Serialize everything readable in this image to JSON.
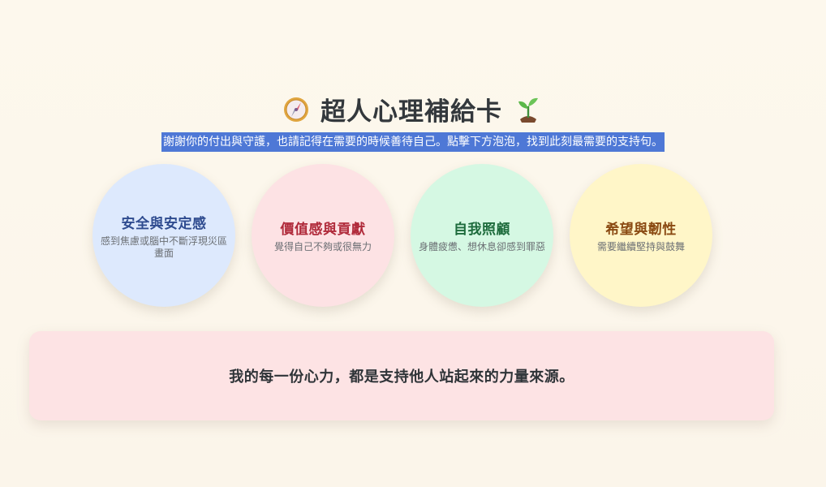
{
  "header": {
    "title": "超人心理補給卡",
    "left_icon": "compass-icon",
    "right_icon": "sprout-icon",
    "subtitle": "謝謝你的付出與守護，也請記得在需要的時候善待自己。點擊下方泡泡，找到此刻最需要的支持句。"
  },
  "bubbles": [
    {
      "title": "安全與安定感",
      "desc": "感到焦慮或腦中不斷浮現災區畫面",
      "color": "#dde9fd"
    },
    {
      "title": "價值感與貢獻",
      "desc": "覺得自己不夠或很無力",
      "color": "#fde2e4"
    },
    {
      "title": "自我照顧",
      "desc": "身體疲憊、想休息卻感到罪惡",
      "color": "#d5f8e3"
    },
    {
      "title": "希望與韌性",
      "desc": "需要繼續堅持與鼓舞",
      "color": "#fff6c8"
    }
  ],
  "card": {
    "quote": "我的每一份心力，都是支持他人站起來的力量來源。",
    "color": "#fde3e4"
  },
  "colors": {
    "background": "#fcf7ec",
    "subtitle_highlight": "#4e78d6"
  }
}
